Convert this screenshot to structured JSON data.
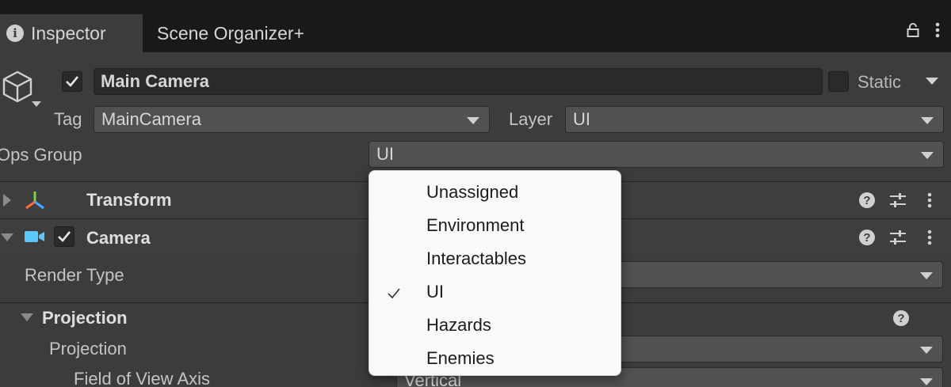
{
  "tabs": {
    "inspector": "Inspector",
    "scene_organizer": "Scene Organizer+"
  },
  "object": {
    "name": "Main Camera",
    "static_label": "Static",
    "tag_label": "Tag",
    "tag_value": "MainCamera",
    "layer_label": "Layer",
    "layer_value": "UI",
    "ops_group_label": "Ops Group",
    "ops_group_value": "UI"
  },
  "components": {
    "transform": "Transform",
    "camera": "Camera"
  },
  "fields": {
    "render_type": "Render Type",
    "projection_section": "Projection",
    "projection": "Projection",
    "fov_axis": "Field of View Axis",
    "fov_axis_value": "Vertical"
  },
  "menu": {
    "items": [
      {
        "label": "Unassigned",
        "selected": false
      },
      {
        "label": "Environment",
        "selected": false
      },
      {
        "label": "Interactables",
        "selected": false
      },
      {
        "label": "UI",
        "selected": true
      },
      {
        "label": "Hazards",
        "selected": false
      },
      {
        "label": "Enemies",
        "selected": false
      }
    ]
  },
  "colors": {
    "panel_bg": "#3c3c3c",
    "tabbar_bg": "#191919",
    "camera_icon": "#5ac8fa",
    "menu_bg": "#f9f9f9"
  }
}
